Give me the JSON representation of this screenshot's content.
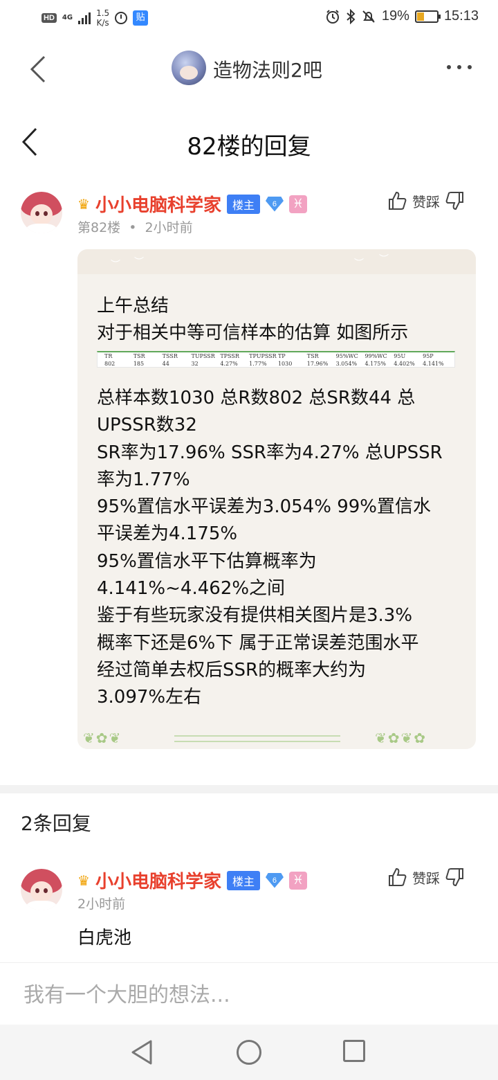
{
  "status_bar": {
    "hd": "HD",
    "network": "4G",
    "speed_value": "1.5",
    "speed_unit": "K/s",
    "tieba_icon_text": "贴",
    "battery": "19%",
    "battery_level": 0.19,
    "time": "15:13"
  },
  "nav": {
    "forum_title": "造物法则2吧"
  },
  "sub_header": {
    "title": "82楼的回复"
  },
  "post": {
    "username": "小小电脑科学家",
    "badge": "楼主",
    "level": "6",
    "zodiac": "♓",
    "floor": "第82楼",
    "separator": "•",
    "time": "2小时前",
    "vote_label": "赞踩",
    "lines_before_table": [
      "上午总结",
      "对于相关中等可信样本的估算 如图所示"
    ],
    "table": {
      "headers": [
        "TR",
        "TSR",
        "TSSR",
        "TUPSSR",
        "TPSSR",
        "TPUPSSR",
        "TP",
        "TSR",
        "95%WC",
        "99%WC",
        "95U",
        "95P"
      ],
      "values": [
        "802",
        "185",
        "44",
        "32",
        "4.27%",
        "1.77%",
        "1030",
        "17.96%",
        "3.054%",
        "4.175%",
        "4.402%",
        "4.141%"
      ]
    },
    "lines_after_table": [
      "总样本数1030 总R数802 总SR数44 总",
      "UPSSR数32",
      "SR率为17.96% SSR率为4.27% 总UPSSR",
      "率为1.77%",
      "95%置信水平误差为3.054% 99%置信水",
      "平误差为4.175%",
      "95%置信水平下估算概率为",
      "4.141%~4.462%之间",
      "鉴于有些玩家没有提供相关图片是3.3%",
      "概率下还是6%下 属于正常误差范围水平",
      "经过简单去权后SSR的概率大约为",
      "3.097%左右"
    ]
  },
  "replies": {
    "count_label": "2条回复",
    "items": [
      {
        "username": "小小电脑科学家",
        "badge": "楼主",
        "level": "6",
        "zodiac": "♓",
        "time": "2小时前",
        "vote_label": "赞踩",
        "text": "白虎池"
      }
    ]
  },
  "input": {
    "placeholder": "我有一个大胆的想法..."
  }
}
